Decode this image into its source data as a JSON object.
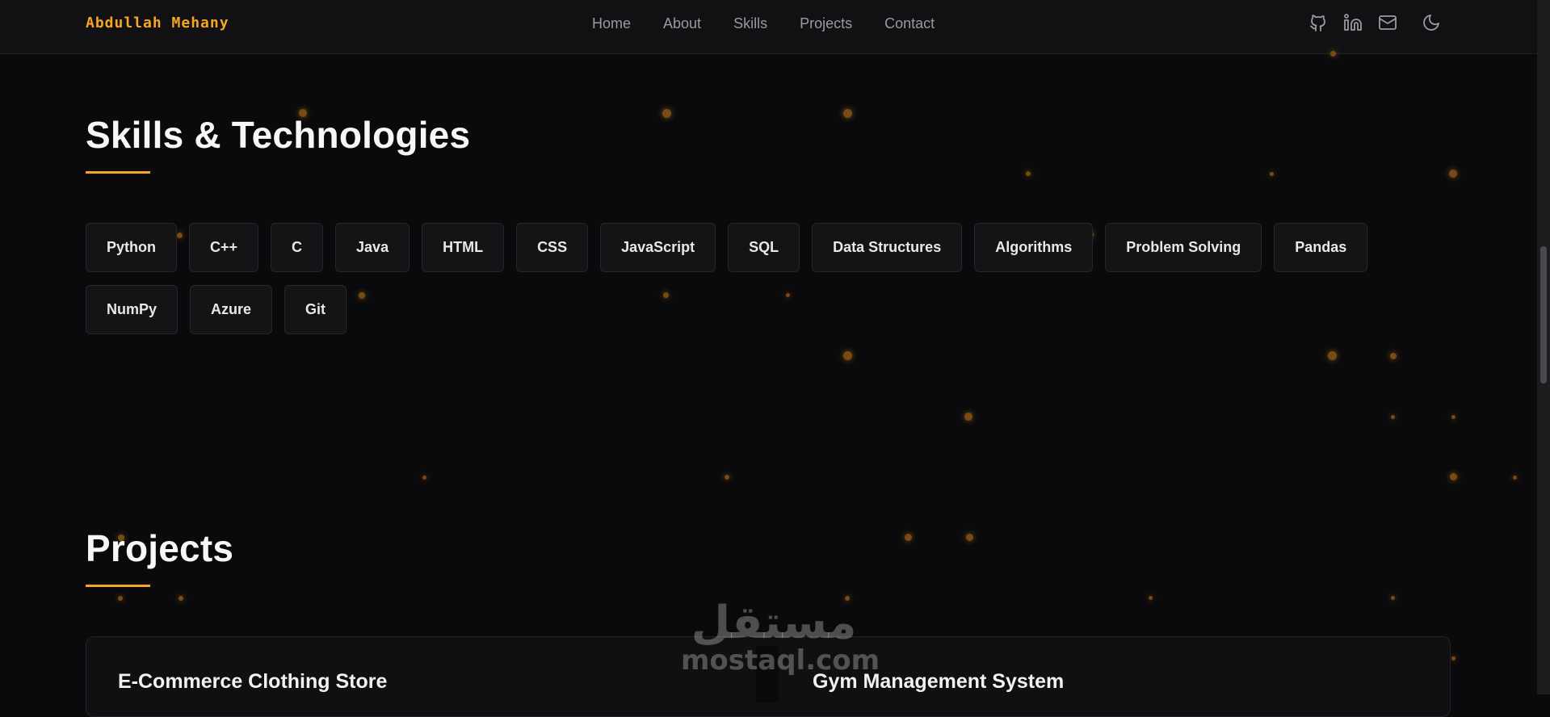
{
  "brand": "Abdullah Mehany",
  "nav": [
    "Home",
    "About",
    "Skills",
    "Projects",
    "Contact"
  ],
  "social": [
    "github-icon",
    "linkedin-icon",
    "mail-icon",
    "moon-icon"
  ],
  "skills_section": {
    "title": "Skills & Technologies",
    "items": [
      "Python",
      "C++",
      "C",
      "Java",
      "HTML",
      "CSS",
      "JavaScript",
      "SQL",
      "Data Structures",
      "Algorithms",
      "Problem Solving",
      "Pandas",
      "NumPy",
      "Azure",
      "Git"
    ]
  },
  "projects_section": {
    "title": "Projects",
    "items": [
      "E-Commerce Clothing Store",
      "Gym Management System"
    ]
  },
  "watermark": {
    "arabic": "مستقل",
    "latin": "mostaql.com"
  },
  "colors": {
    "accent": "#f5a623",
    "background": "#0a0a0c"
  }
}
